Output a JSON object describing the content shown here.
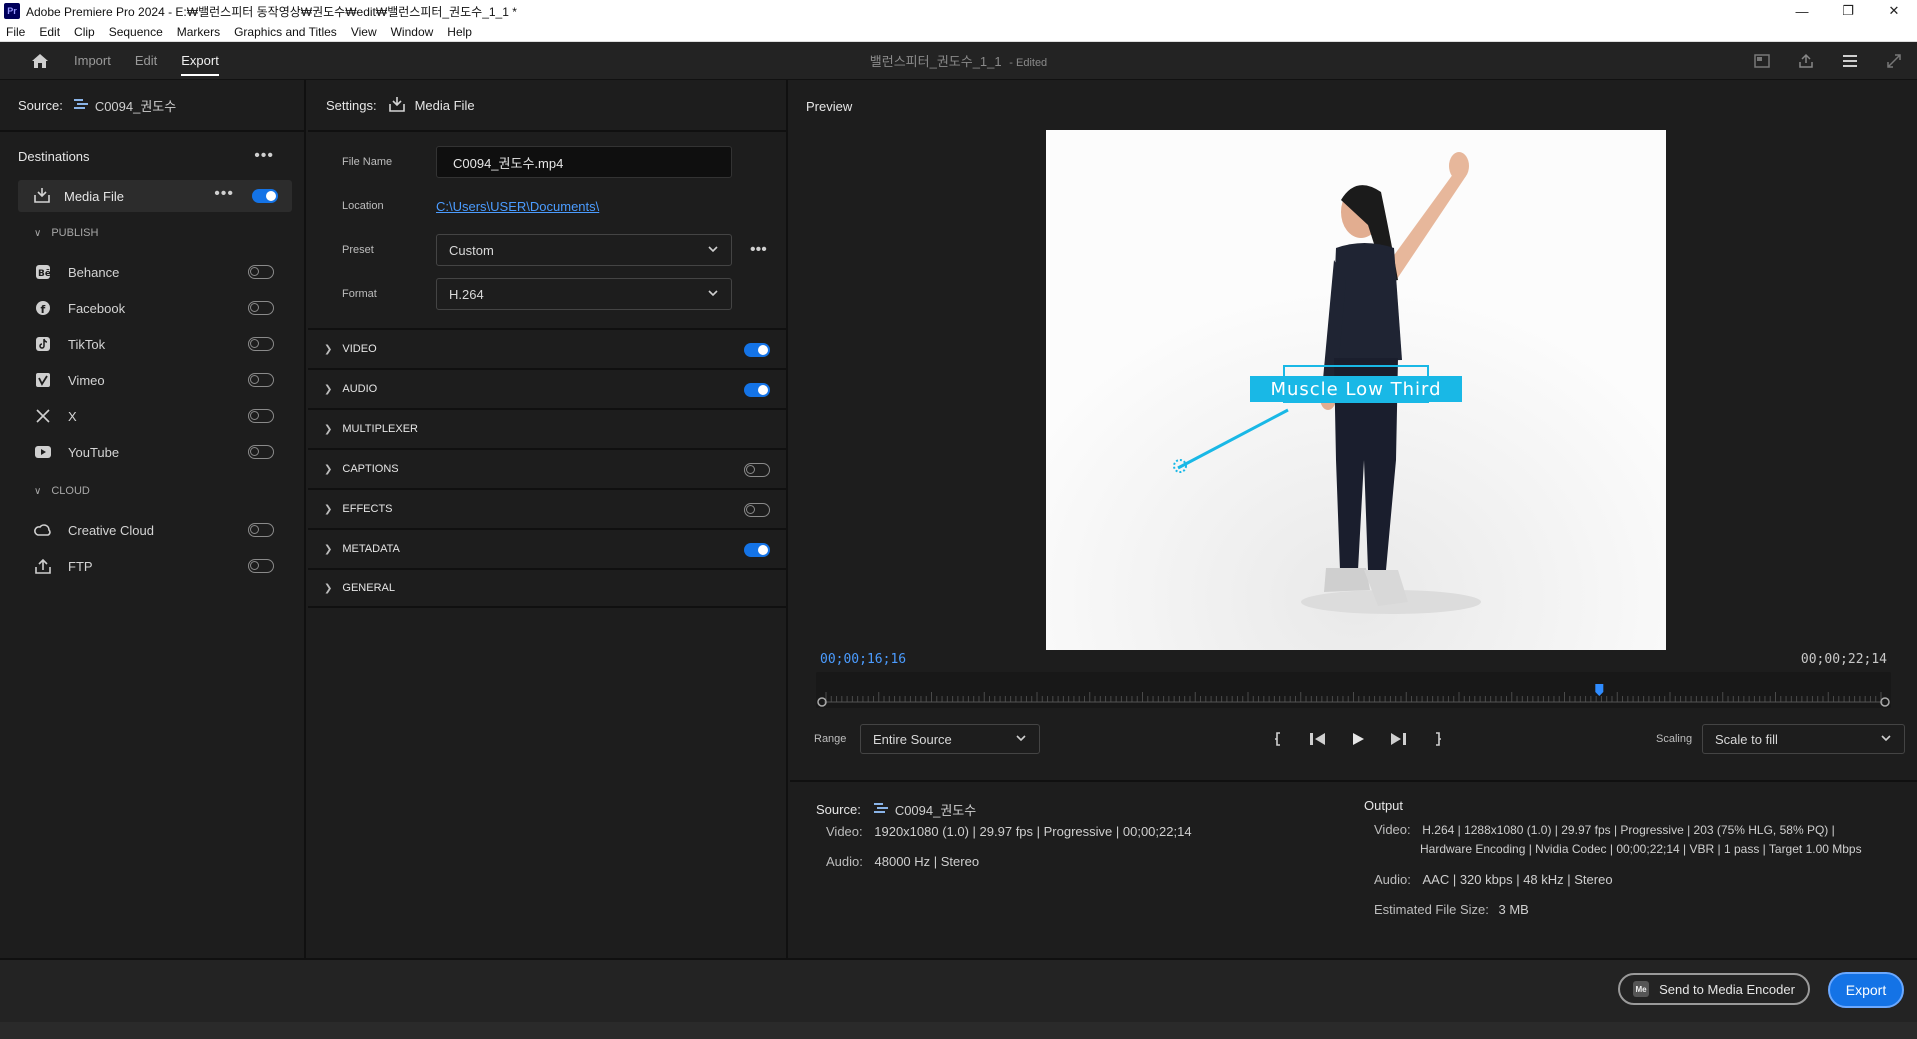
{
  "window": {
    "app_badge": "Pr",
    "title": "Adobe Premiere Pro 2024 - E:₩밸런스피터 동작영상₩권도수₩edit₩밸런스피터_권도수_1_1 *"
  },
  "menu": [
    "File",
    "Edit",
    "Clip",
    "Sequence",
    "Markers",
    "Graphics and Titles",
    "View",
    "Window",
    "Help"
  ],
  "header": {
    "tabs": [
      "Import",
      "Edit",
      "Export"
    ],
    "active_tab": "Export",
    "doc_title": "밸런스피터_권도수_1_1",
    "doc_status": "- Edited"
  },
  "source": {
    "label": "Source:",
    "value": "C0094_권도수"
  },
  "destinations": {
    "title": "Destinations",
    "media_file": {
      "label": "Media File",
      "enabled": true
    },
    "publish_label": "PUBLISH",
    "publish": [
      {
        "label": "Behance",
        "icon": "behance-icon",
        "enabled": false
      },
      {
        "label": "Facebook",
        "icon": "facebook-icon",
        "enabled": false
      },
      {
        "label": "TikTok",
        "icon": "tiktok-icon",
        "enabled": false
      },
      {
        "label": "Vimeo",
        "icon": "vimeo-icon",
        "enabled": false
      },
      {
        "label": "X",
        "icon": "x-icon",
        "enabled": false
      },
      {
        "label": "YouTube",
        "icon": "youtube-icon",
        "enabled": false
      }
    ],
    "cloud_label": "CLOUD",
    "cloud": [
      {
        "label": "Creative Cloud",
        "icon": "creative-cloud-icon",
        "enabled": false
      },
      {
        "label": "FTP",
        "icon": "ftp-icon",
        "enabled": false
      }
    ]
  },
  "settings": {
    "label": "Settings:",
    "value": "Media File",
    "file_name_label": "File Name",
    "file_name": "C0094_권도수.mp4",
    "location_label": "Location",
    "location": "C:\\Users\\USER\\Documents\\",
    "preset_label": "Preset",
    "preset": "Custom",
    "format_label": "Format",
    "format": "H.264",
    "sections": [
      {
        "label": "VIDEO",
        "toggle": true,
        "enabled": true
      },
      {
        "label": "AUDIO",
        "toggle": true,
        "enabled": true
      },
      {
        "label": "MULTIPLEXER",
        "toggle": false
      },
      {
        "label": "CAPTIONS",
        "toggle": true,
        "enabled": false
      },
      {
        "label": "EFFECTS",
        "toggle": true,
        "enabled": false
      },
      {
        "label": "METADATA",
        "toggle": true,
        "enabled": true
      },
      {
        "label": "GENERAL",
        "toggle": false
      }
    ]
  },
  "preview": {
    "title": "Preview",
    "overlay_text": "Muscle Low Third",
    "current_time": "00;00;16;16",
    "duration": "00;00;22;14",
    "playhead_fraction": 0.733,
    "range_label": "Range",
    "range_value": "Entire Source",
    "scaling_label": "Scaling",
    "scaling_value": "Scale to fill"
  },
  "source_info": {
    "label": "Source:",
    "name": "C0094_권도수",
    "video_label": "Video:",
    "video": "1920x1080 (1.0)  |  29.97 fps  |  Progressive  |  00;00;22;14",
    "audio_label": "Audio:",
    "audio": "48000 Hz  |  Stereo"
  },
  "output_info": {
    "label": "Output",
    "video_label": "Video:",
    "video_line1": "H.264  |  1288x1080 (1.0)  |  29.97 fps  |  Progressive  |  203 (75% HLG, 58% PQ)  |",
    "video_line2": "Hardware Encoding  |  Nvidia Codec  |  00;00;22;14  |  VBR  |  1 pass  |  Target 1.00 Mbps",
    "audio_label": "Audio:",
    "audio": "AAC  |  320 kbps  |  48 kHz  |  Stereo",
    "size_label": "Estimated File Size:",
    "size": "3 MB"
  },
  "footer": {
    "encoder_badge": "Me",
    "send_label": "Send to Media Encoder",
    "export_label": "Export"
  },
  "colors": {
    "accent": "#1473e6",
    "link": "#4b9cff",
    "overlay": "#19b8e6"
  }
}
